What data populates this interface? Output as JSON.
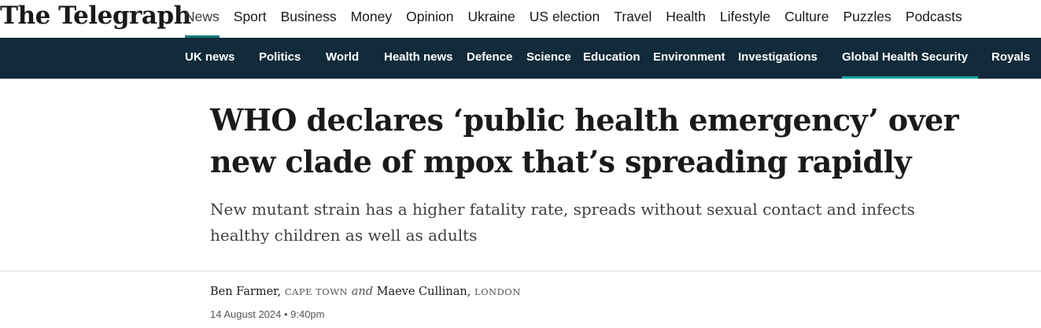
{
  "brand": {
    "logo_text": "The Telegraph"
  },
  "main_nav": {
    "items": [
      "News",
      "Sport",
      "Business",
      "Money",
      "Opinion",
      "Ukraine",
      "US election",
      "Travel",
      "Health",
      "Lifestyle",
      "Culture",
      "Puzzles",
      "Podcasts"
    ],
    "active": "News"
  },
  "section_nav": {
    "items": [
      "UK news",
      "Politics",
      "World",
      "Health news",
      "Defence",
      "Science",
      "Education",
      "Environment",
      "Investigations",
      "Global Health Security",
      "Royals"
    ],
    "active": "Global Health Security"
  },
  "article": {
    "headline_line1": "WHO declares ‘public health emergency’ over",
    "headline_line2": "new clade of mpox that’s spreading rapidly",
    "standfirst_line1": "New mutant strain has a higher fatality rate, spreads without sexual contact and infects",
    "standfirst_line2": "healthy children as well as adults",
    "byline": {
      "author1": "Ben Farmer,",
      "location1": "CAPE TOWN",
      "conjunction": "and",
      "author2": "Maeve Cullinan,",
      "location2": "LONDON"
    },
    "date": "14 August 2024 • 9:40pm"
  },
  "colors": {
    "nav_bar": "#122b3a",
    "accent": "#0c7b77"
  }
}
